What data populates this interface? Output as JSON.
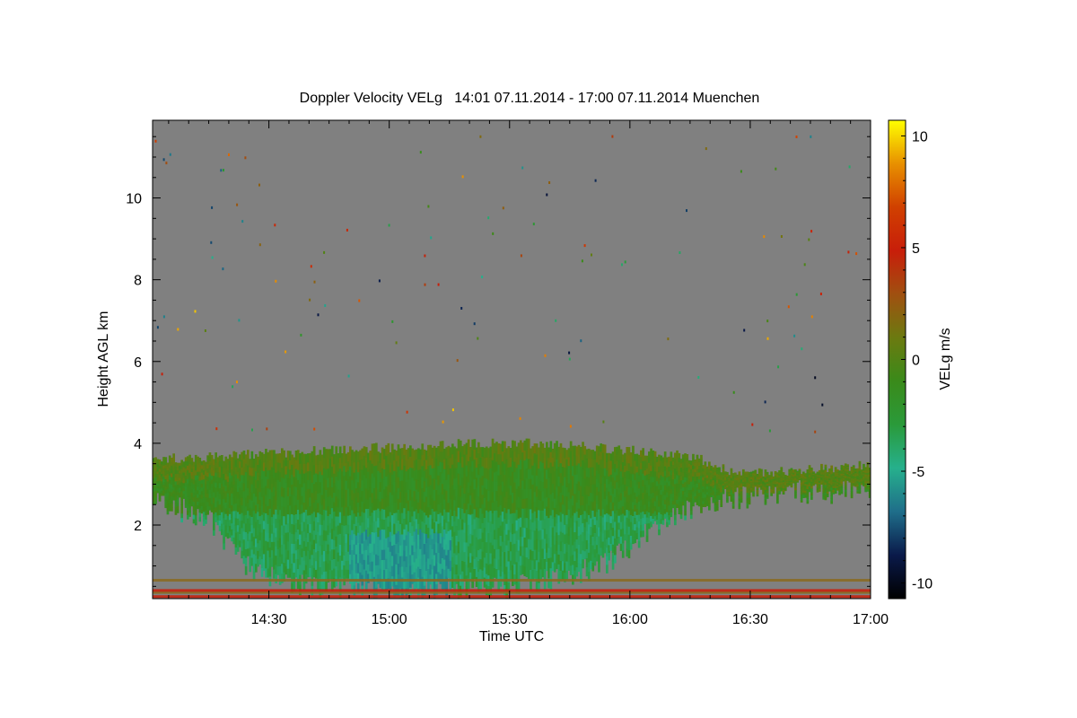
{
  "chart_data": {
    "type": "heatmap",
    "title": "Doppler Velocity VELg   14:01 07.11.2014 - 17:00 07.11.2014 Muenchen",
    "xlabel": "Time UTC",
    "ylabel": "Height AGL km",
    "colorbar_label": "VELg m/s",
    "x_range": [
      "14:01",
      "17:00"
    ],
    "xlim_minutes_utc": [
      841,
      1020
    ],
    "ylim_km": [
      0.2,
      11.9
    ],
    "x_ticks": [
      {
        "label": "14:30",
        "value": 870
      },
      {
        "label": "15:00",
        "value": 900
      },
      {
        "label": "15:30",
        "value": 930
      },
      {
        "label": "16:00",
        "value": 960
      },
      {
        "label": "16:30",
        "value": 990
      },
      {
        "label": "17:00",
        "value": 1020
      }
    ],
    "y_ticks": [
      {
        "label": "2",
        "value": 2
      },
      {
        "label": "4",
        "value": 4
      },
      {
        "label": "6",
        "value": 6
      },
      {
        "label": "8",
        "value": 8
      },
      {
        "label": "10",
        "value": 10
      }
    ],
    "colorbar": {
      "vmin": -10.7,
      "vmax": 10.7,
      "ticks": [
        {
          "label": "10",
          "value": 10
        },
        {
          "label": "5",
          "value": 5
        },
        {
          "label": "0",
          "value": 0
        },
        {
          "label": "-5",
          "value": -5
        },
        {
          "label": "-10",
          "value": -10
        }
      ],
      "colormap": [
        "#000000",
        "#0a1a4a",
        "#1f6e8a",
        "#26b08c",
        "#2a9a3a",
        "#3a8a1a",
        "#6b7a10",
        "#a05010",
        "#c81e0a",
        "#d04000",
        "#e89000",
        "#ffff00"
      ]
    },
    "background_color": "#808080",
    "cloud_top_km": [
      {
        "t": 841,
        "top": 3.6
      },
      {
        "t": 860,
        "top": 3.7
      },
      {
        "t": 880,
        "top": 3.8
      },
      {
        "t": 900,
        "top": 3.9
      },
      {
        "t": 920,
        "top": 4.0
      },
      {
        "t": 935,
        "top": 4.0
      },
      {
        "t": 950,
        "top": 3.9
      },
      {
        "t": 965,
        "top": 3.8
      },
      {
        "t": 975,
        "top": 3.7
      },
      {
        "t": 985,
        "top": 3.3
      },
      {
        "t": 1000,
        "top": 3.3
      },
      {
        "t": 1010,
        "top": 3.4
      },
      {
        "t": 1020,
        "top": 3.5
      }
    ],
    "cloud_base_km": [
      {
        "t": 841,
        "base": 2.5
      },
      {
        "t": 855,
        "base": 2.0
      },
      {
        "t": 865,
        "base": 0.8
      },
      {
        "t": 875,
        "base": 0.5
      },
      {
        "t": 885,
        "base": 0.3
      },
      {
        "t": 925,
        "base": 0.3
      },
      {
        "t": 940,
        "base": 0.5
      },
      {
        "t": 955,
        "base": 1.0
      },
      {
        "t": 965,
        "base": 1.8
      },
      {
        "t": 975,
        "base": 2.3
      },
      {
        "t": 990,
        "base": 2.6
      },
      {
        "t": 1000,
        "base": 2.7
      },
      {
        "t": 1020,
        "base": 2.7
      }
    ],
    "strongest_downdraft": {
      "t_range": [
        890,
        915
      ],
      "height_km": [
        0.3,
        1.8
      ],
      "velocity_ms": -5.5
    },
    "near_surface_layers_km": [
      0.25,
      0.35,
      0.4,
      0.65
    ]
  }
}
